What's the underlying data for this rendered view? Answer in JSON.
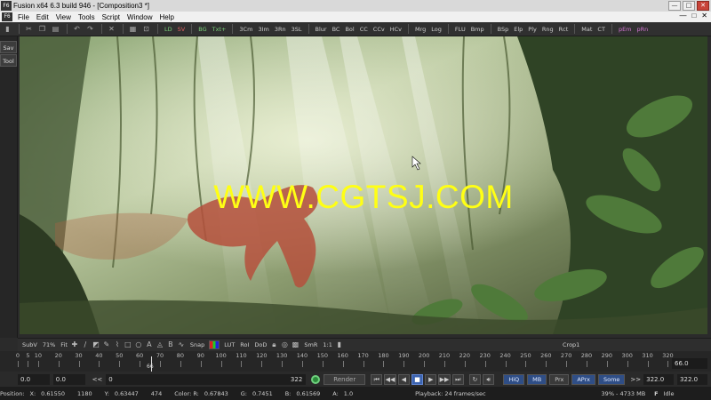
{
  "window": {
    "title": "Fusion x64 6.3 build 946 - [Composition3 *]",
    "app_badge": "F6",
    "controls": [
      "—",
      "□",
      "✕"
    ]
  },
  "menu": {
    "items": [
      "File",
      "Edit",
      "View",
      "Tools",
      "Script",
      "Window",
      "Help"
    ],
    "doc_controls": [
      "—",
      "□",
      "✕"
    ]
  },
  "toolbar": {
    "tools": [
      "LD",
      "SV",
      "BG",
      "Txt+",
      "3Cm",
      "3Im",
      "3Rn",
      "3SL",
      "Blur",
      "BC",
      "Bol",
      "CC",
      "CCv",
      "HCv",
      "Mrg",
      "Log",
      "FLU",
      "Bmp",
      "BSp",
      "Elp",
      "Ply",
      "Rng",
      "Rct",
      "Mat",
      "CT",
      "pEm",
      "pRn"
    ],
    "tool_colors": {
      "LD": "#7ad27a",
      "SV": "#e06060",
      "BG": "#7ad27a",
      "Txt+": "#7ad27a",
      "pEm": "#d074d0",
      "pRn": "#d074d0"
    }
  },
  "left_tabs": [
    "Sav",
    "Tool"
  ],
  "viewer": {
    "watermark": "WWW.CGTSJ.COM"
  },
  "viewer_controls": {
    "subv": "SubV",
    "zoom": "71%",
    "fit": "Fit",
    "snap": "Snap",
    "lut": "LUT",
    "roi": "RoI",
    "dod": "DoD",
    "smr": "SmR",
    "ratio": "1:1",
    "node": "Crop1"
  },
  "timeline": {
    "ticks": [
      "0",
      "5",
      "10",
      "20",
      "30",
      "40",
      "50",
      "60",
      "70",
      "80",
      "90",
      "100",
      "110",
      "120",
      "130",
      "140",
      "150",
      "160",
      "170",
      "180",
      "190",
      "200",
      "210",
      "220",
      "230",
      "240",
      "250",
      "260",
      "270",
      "280",
      "290",
      "300",
      "310",
      "320"
    ],
    "playhead_label": "66",
    "current": "66.0"
  },
  "transport": {
    "start": "0.0",
    "render_start": "0.0",
    "prev": "<<",
    "current_frame": "0",
    "end_frame": "322",
    "render_label": "Render",
    "modes": [
      "HiQ",
      "MB",
      "Prx",
      "APrx",
      "Some"
    ],
    "next": ">>",
    "render_end": "322.0",
    "end": "322.0"
  },
  "status": {
    "position": "Position:",
    "x_label": "X:",
    "x_val": "0.61550",
    "x_px": "1180",
    "y_label": "Y:",
    "y_val": "0.63447",
    "y_px": "474",
    "color": "Color: R:",
    "r_val": "0.67843",
    "g_label": "G:",
    "g_val": "0.7451",
    "b_label": "B:",
    "b_val": "0.61569",
    "a_label": "A:",
    "a_val": "1.0",
    "playback": "Playback: 24 frames/sec",
    "mem": "39% - 4733 MB",
    "state": "Idle"
  }
}
